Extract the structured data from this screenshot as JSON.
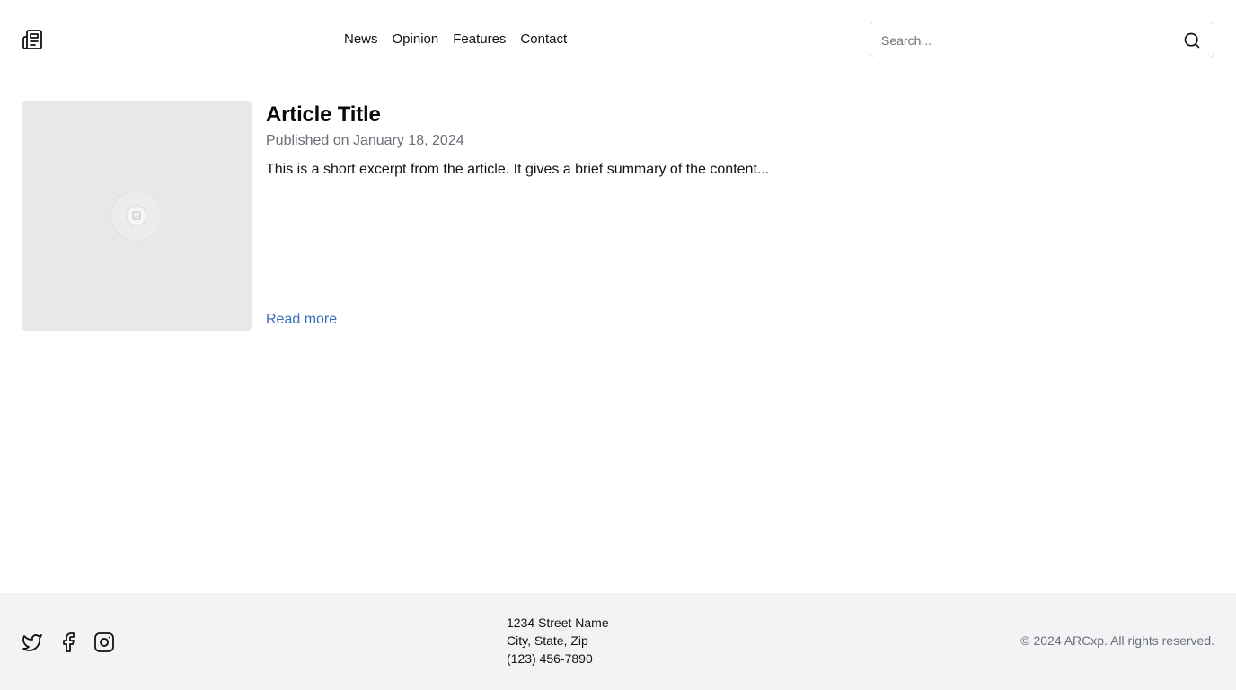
{
  "header": {
    "logo_icon": "newspaper-icon",
    "nav": [
      {
        "label": "News"
      },
      {
        "label": "Opinion"
      },
      {
        "label": "Features"
      },
      {
        "label": "Contact"
      }
    ],
    "search": {
      "placeholder": "Search...",
      "value": "",
      "icon": "search-icon"
    }
  },
  "article": {
    "image_icon": "image-placeholder-icon",
    "title": "Article Title",
    "date": "Published on January 18, 2024",
    "excerpt": "This is a short excerpt from the article. It gives a brief summary of the content...",
    "read_more": "Read more"
  },
  "footer": {
    "social": [
      "twitter-icon",
      "facebook-icon",
      "instagram-icon"
    ],
    "address": {
      "street": "1234 Street Name",
      "city": "City, State, Zip",
      "phone": "(123) 456-7890"
    },
    "copyright": "© 2024 ARCxp. All rights reserved."
  },
  "colors": {
    "link": "#3a6fb8",
    "muted_text": "#6b6f76",
    "footer_bg": "#f2f3f5",
    "image_bg": "#e8e8e8"
  }
}
